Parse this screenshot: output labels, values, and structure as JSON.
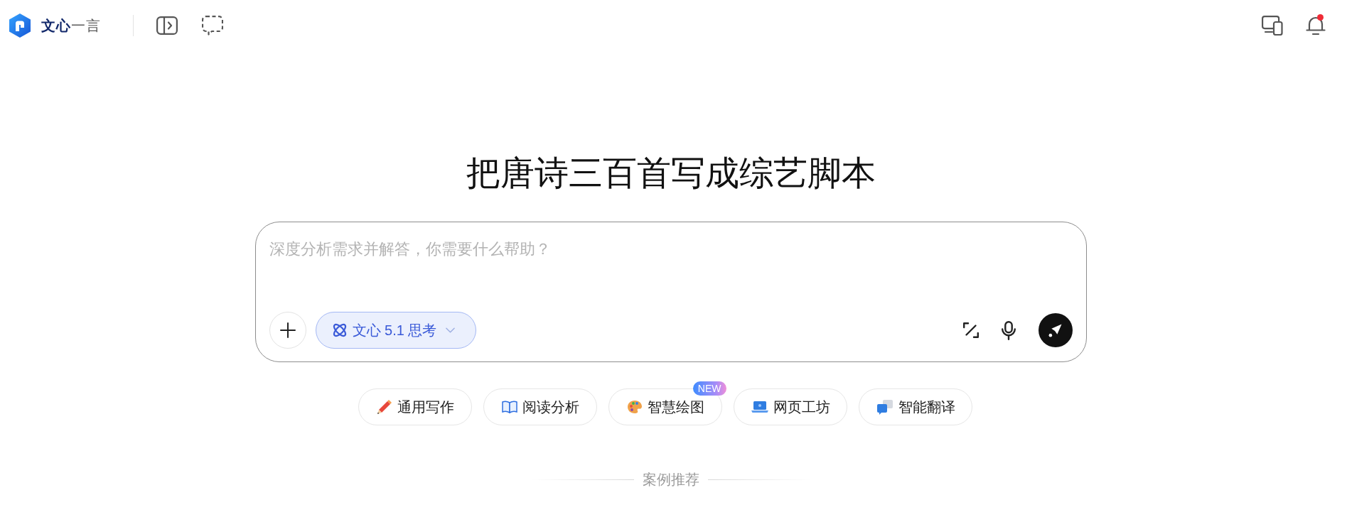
{
  "header": {
    "logo": "**文心**一言",
    "notifications": {
      "unread": true
    }
  },
  "hero": {
    "title": "把唐诗三百首写成综艺脚本"
  },
  "composer": {
    "placeholder": "深度分析需求并解答，你需要什么帮助？",
    "model": {
      "label": "文心 5.1 思考"
    }
  },
  "tools": [
    {
      "kind": "pencil",
      "label": "通用写作"
    },
    {
      "kind": "book",
      "label": "阅读分析"
    },
    {
      "kind": "palette",
      "label": "智慧绘图",
      "badge": "NEW"
    },
    {
      "kind": "laptop",
      "label": "网页工坊"
    },
    {
      "kind": "translate",
      "label": "智能翻译"
    }
  ],
  "section": {
    "label": "案例推荐"
  }
}
